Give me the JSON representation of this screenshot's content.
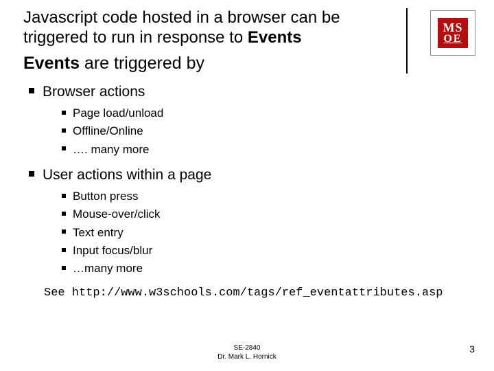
{
  "title": {
    "line1": "Javascript code hosted in a browser can be",
    "line2_pre": "triggered to run in response to ",
    "line2_bold": "Events"
  },
  "subhead": {
    "pre": "Events",
    "post": " are triggered by"
  },
  "groups": [
    {
      "heading": "Browser actions",
      "items": [
        "Page load/unload",
        "Offline/Online",
        "…. many more"
      ]
    },
    {
      "heading": "User actions within a page",
      "items": [
        "Button press",
        "Mouse-over/click",
        "Text entry",
        "Input focus/blur",
        "…many more"
      ]
    }
  ],
  "see_link": "See http://www.w3schools.com/tags/ref_eventattributes.asp",
  "footer": {
    "course": "SE-2840",
    "author": "Dr. Mark L. Hornick"
  },
  "page_number": "3",
  "logo": {
    "top": "MS",
    "bottom": "OE"
  }
}
